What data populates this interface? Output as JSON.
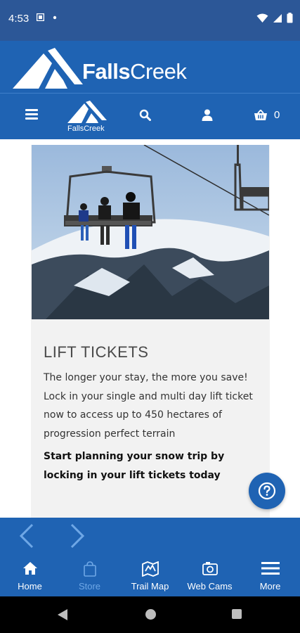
{
  "status_bar": {
    "time": "4:53"
  },
  "brand": {
    "name_bold": "Falls",
    "name_regular": "Creek",
    "small_logo_text": "FallsCreek"
  },
  "nav": {
    "cart_count": "0"
  },
  "card": {
    "title": "LIFT TICKETS",
    "body": "The longer your stay, the more you save! Lock in your single and multi day lift ticket now to access up to 450 hectares of progression perfect terrain",
    "cta": "Start planning your snow trip by locking in your lift tickets today"
  },
  "tabs": [
    {
      "label": "Home",
      "icon": "home-icon"
    },
    {
      "label": "Store",
      "icon": "store-icon"
    },
    {
      "label": "Trail Map",
      "icon": "trail-map-icon"
    },
    {
      "label": "Web Cams",
      "icon": "camera-icon"
    },
    {
      "label": "More",
      "icon": "menu-icon"
    }
  ],
  "colors": {
    "brand_blue": "#1f63b3",
    "status_blue": "#2c5797",
    "inactive_tab": "#6ea7e6"
  }
}
